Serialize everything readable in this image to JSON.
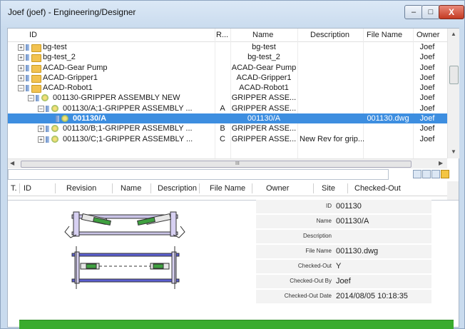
{
  "window": {
    "title": "Joef (joef) - Engineering/Designer",
    "minimize_glyph": "–",
    "maximize_glyph": "□",
    "close_glyph": "X"
  },
  "tree": {
    "columns": {
      "id": "ID",
      "rev": "R...",
      "name": "Name",
      "description": "Description",
      "file_name": "File Name",
      "owner": "Owner"
    },
    "rows": [
      {
        "label": "bg-test",
        "rev": "",
        "name": "bg-test",
        "description": "",
        "file": "",
        "owner": "Joef",
        "expander": "+",
        "icon": "folder-icon"
      },
      {
        "label": "bg-test_2",
        "rev": "",
        "name": "bg-test_2",
        "description": "",
        "file": "",
        "owner": "Joef",
        "expander": "+",
        "icon": "folder-icon"
      },
      {
        "label": "ACAD-Gear Pump",
        "rev": "",
        "name": "ACAD-Gear Pump",
        "description": "",
        "file": "",
        "owner": "Joef",
        "expander": "+",
        "icon": "folder-icon"
      },
      {
        "label": "ACAD-Gripper1",
        "rev": "",
        "name": "ACAD-Gripper1",
        "description": "",
        "file": "",
        "owner": "Joef",
        "expander": "+",
        "icon": "folder-icon"
      },
      {
        "label": "ACAD-Robot1",
        "rev": "",
        "name": "ACAD-Robot1",
        "description": "",
        "file": "",
        "owner": "Joef",
        "expander": "–",
        "icon": "folder-icon"
      },
      {
        "label": "001130-GRIPPER ASSEMBLY NEW",
        "rev": "",
        "name": "GRIPPER ASSE...",
        "description": "",
        "file": "",
        "owner": "Joef",
        "expander": "–",
        "icon": "assembly-icon"
      },
      {
        "label": "001130/A;1-GRIPPER ASSEMBLY ...",
        "rev": "A",
        "name": "GRIPPER ASSE...",
        "description": "",
        "file": "",
        "owner": "Joef",
        "expander": "–",
        "icon": "assembly-icon"
      },
      {
        "label": "001130/A",
        "rev": "",
        "name": "001130/A",
        "description": "",
        "file": "001130.dwg",
        "owner": "Joef",
        "expander": "",
        "icon": "drawing-icon",
        "selected": true
      },
      {
        "label": "001130/B;1-GRIPPER ASSEMBLY ...",
        "rev": "B",
        "name": "GRIPPER ASSE...",
        "description": "",
        "file": "",
        "owner": "Joef",
        "expander": "+",
        "icon": "assembly-icon"
      },
      {
        "label": "001130/C;1-GRIPPER ASSEMBLY ...",
        "rev": "C",
        "name": "GRIPPER ASSE...",
        "description": "New Rev for grip...",
        "file": "",
        "owner": "Joef",
        "expander": "+",
        "icon": "assembly-icon"
      }
    ],
    "hscroll_grip": "III"
  },
  "list": {
    "columns": [
      "T.",
      "ID",
      "Revision",
      "Name",
      "Description",
      "File Name",
      "Owner",
      "Site",
      "Checked-Out"
    ]
  },
  "details": {
    "properties": [
      {
        "key": "ID",
        "value": "001130"
      },
      {
        "key": "Name",
        "value": "001130/A"
      },
      {
        "key": "Description",
        "value": ""
      },
      {
        "key": "File Name",
        "value": "001130.dwg"
      },
      {
        "key": "Checked-Out",
        "value": "Y"
      },
      {
        "key": "Checked-Out By",
        "value": "Joef"
      },
      {
        "key": "Checked-Out Date",
        "value": "2014/08/05 10:18:35"
      }
    ]
  },
  "colors": {
    "selection": "#3d8ee0",
    "status_bar": "#3aac2e",
    "folder": "#f2c250"
  }
}
